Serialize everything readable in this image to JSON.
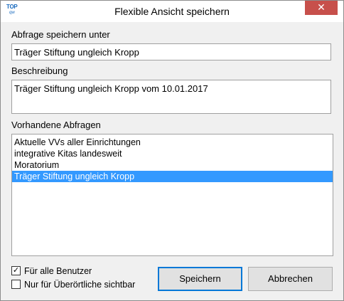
{
  "window": {
    "title": "Flexible Ansicht speichern",
    "close_glyph": "✕",
    "app_icon_top": "TOP",
    "app_icon_sub": "qw"
  },
  "save_as": {
    "label": "Abfrage speichern unter",
    "value": "Träger Stiftung ungleich Kropp"
  },
  "description": {
    "label": "Beschreibung",
    "value": "Träger Stiftung ungleich Kropp vom 10.01.2017"
  },
  "existing": {
    "label": "Vorhandene Abfragen",
    "items": [
      "Aktuelle VVs aller Einrichtungen",
      "integrative Kitas landesweit",
      "Moratorium",
      "Träger Stiftung ungleich Kropp"
    ],
    "selected_index": 3
  },
  "options": {
    "all_users": {
      "label": "Für alle Benutzer",
      "checked": true,
      "check_glyph": "✓"
    },
    "supra_local": {
      "label": "Nur für Überörtliche sichtbar",
      "checked": false
    }
  },
  "buttons": {
    "save": "Speichern",
    "cancel": "Abbrechen"
  },
  "colors": {
    "selection": "#3399ff",
    "close_button": "#c7504b",
    "default_button_border": "#0078d7"
  }
}
